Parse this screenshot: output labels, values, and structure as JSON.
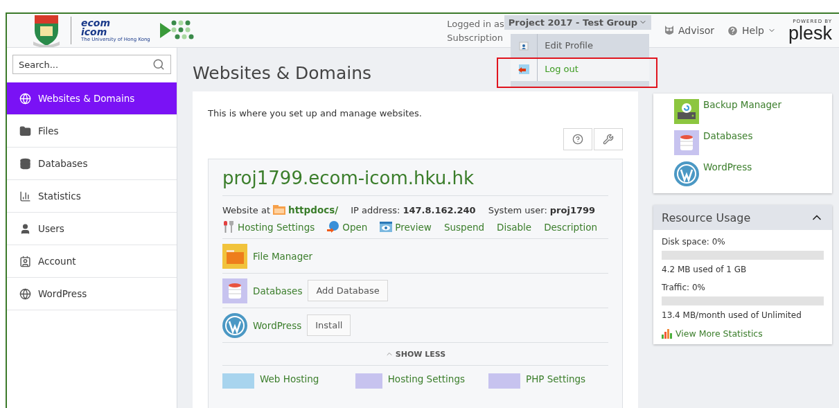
{
  "header": {
    "logged_in_label": "Logged in as",
    "account": "Project 2017 - Test Group",
    "subscription_label": "Subscription",
    "advisor": "Advisor",
    "help": "Help",
    "powered_by": "POWERED BY",
    "brand": "plesk",
    "logo_top": "ecom",
    "logo_bottom": "icom",
    "logo_caption": "The University of Hong Kong"
  },
  "user_menu": {
    "items": [
      {
        "label": "Edit Profile",
        "highlighted": false
      },
      {
        "label": "Log out",
        "highlighted": true
      }
    ]
  },
  "sidebar": {
    "search": {
      "placeholder": "Search..."
    },
    "items": [
      {
        "label": "Websites & Domains",
        "selected": true
      },
      {
        "label": "Files",
        "selected": false
      },
      {
        "label": "Databases",
        "selected": false
      },
      {
        "label": "Statistics",
        "selected": false
      },
      {
        "label": "Users",
        "selected": false
      },
      {
        "label": "Account",
        "selected": false
      },
      {
        "label": "WordPress",
        "selected": false
      }
    ]
  },
  "page_title": "Websites & Domains",
  "intro": "This is where you set up and manage websites.",
  "domain": {
    "name": "proj1799.ecom-icom.hku.hk",
    "website_at_label": "Website at",
    "path": "httpdocs/",
    "ip_label": "IP address:",
    "ip": "147.8.162.240",
    "user_label": "System user:",
    "user": "proj1799",
    "actions": [
      "Hosting Settings",
      "Open",
      "Preview",
      "Suspend",
      "Disable",
      "Description"
    ],
    "tools": [
      {
        "label": "File Manager"
      },
      {
        "label": "Databases",
        "button": "Add Database"
      },
      {
        "label": "WordPress",
        "button": "Install"
      }
    ],
    "show_less": "SHOW LESS",
    "tiles": [
      "Web Hosting",
      "Hosting Settings",
      "PHP Settings"
    ]
  },
  "quick_links": [
    "Backup Manager",
    "Databases",
    "WordPress"
  ],
  "resource_usage": {
    "title": "Resource Usage",
    "rows": [
      {
        "label": "Disk space: 0%",
        "level": 0,
        "detail": "4.2 MB used of 1 GB"
      },
      {
        "label": "Traffic: 0%",
        "level": 0,
        "detail": "13.4 MB/month used of Unlimited"
      }
    ],
    "stats_link": "View More Statistics"
  }
}
